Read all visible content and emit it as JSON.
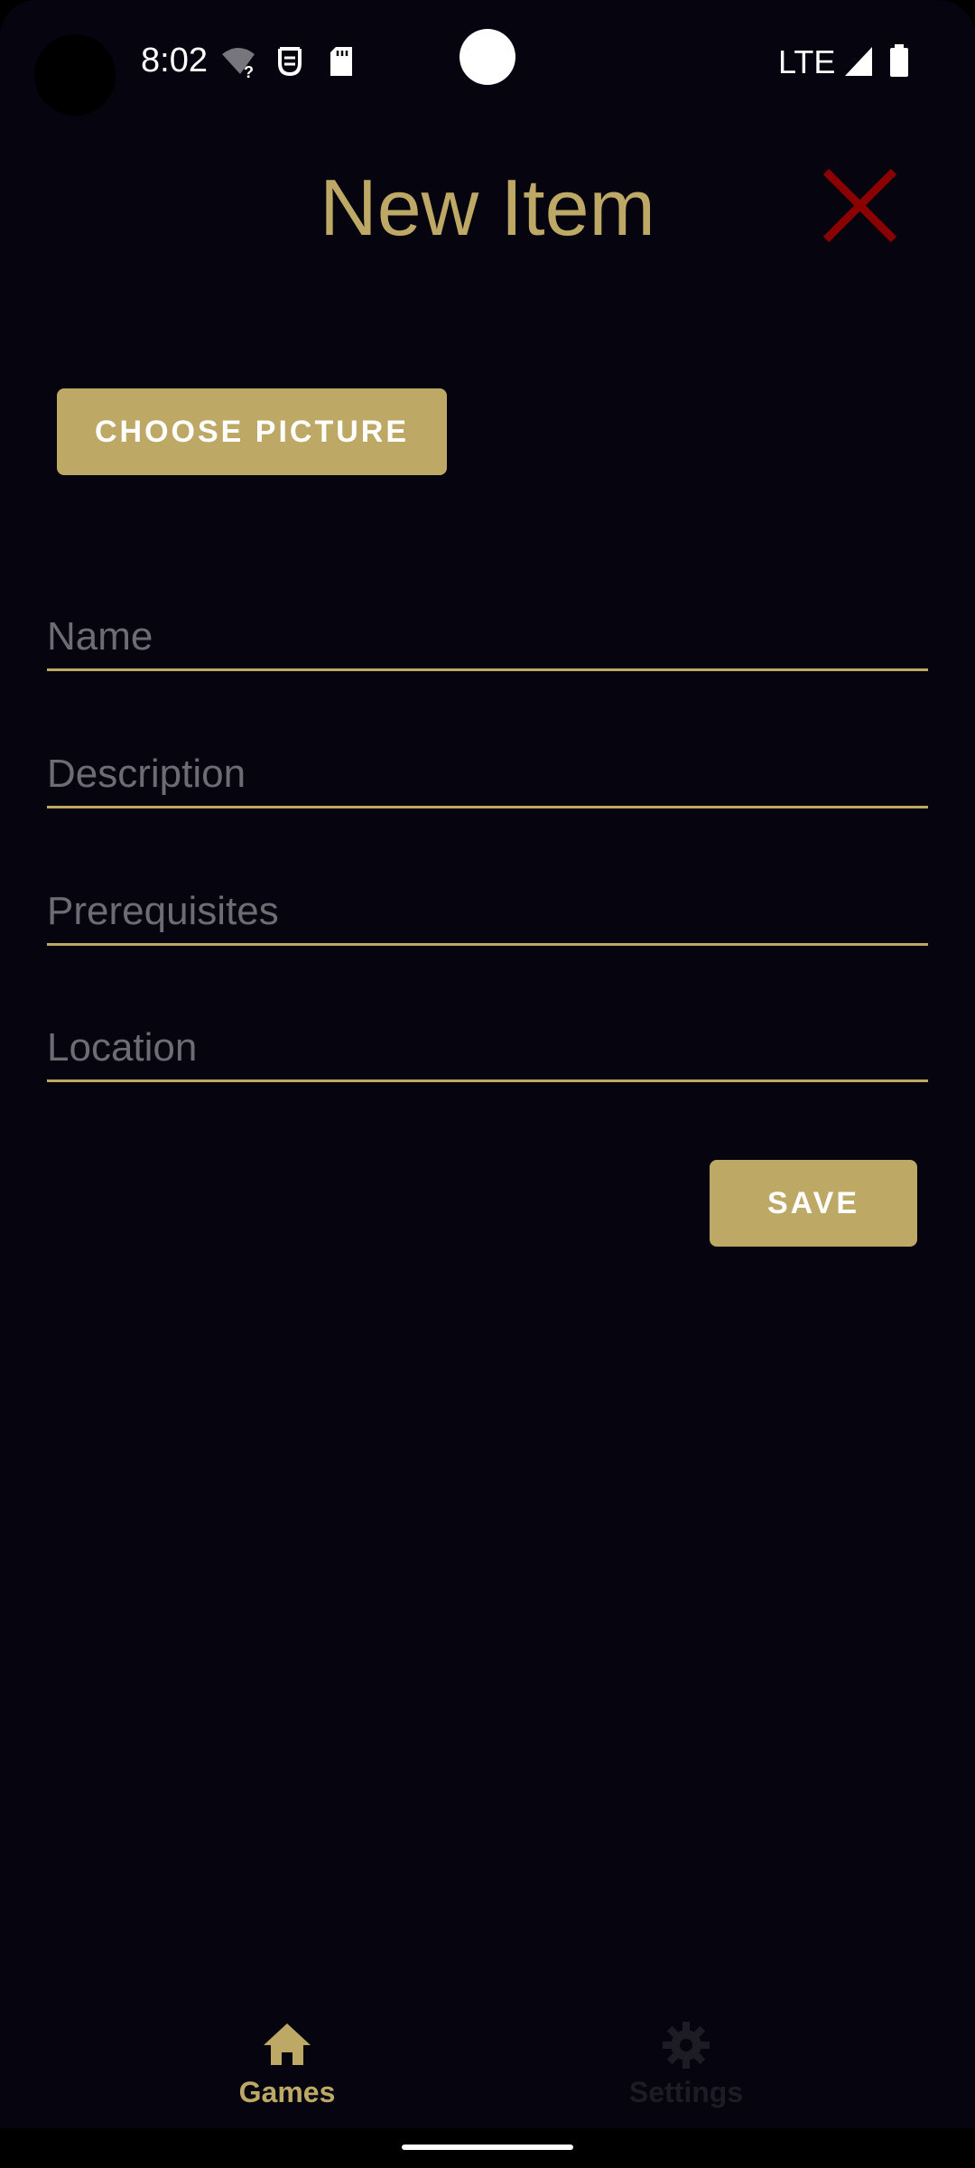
{
  "status_bar": {
    "time": "8:02",
    "network": "LTE",
    "icons": [
      "wifi-unknown-icon",
      "privacy-icon",
      "sd-card-icon",
      "signal-icon",
      "battery-icon"
    ]
  },
  "header": {
    "title": "New Item",
    "close_icon": "close-icon"
  },
  "form": {
    "choose_picture_label": "CHOOSE PICTURE",
    "fields": [
      {
        "placeholder": "Name",
        "value": ""
      },
      {
        "placeholder": "Description",
        "value": ""
      },
      {
        "placeholder": "Prerequisites",
        "value": ""
      },
      {
        "placeholder": "Location",
        "value": ""
      }
    ],
    "save_label": "SAVE"
  },
  "bottom_nav": {
    "items": [
      {
        "label": "Games",
        "icon": "home-icon",
        "active": true
      },
      {
        "label": "Settings",
        "icon": "gear-icon",
        "active": false
      }
    ]
  },
  "colors": {
    "accent": "#bea866",
    "background": "#05040f",
    "close": "#8b0000",
    "placeholder": "#6e6c73",
    "inactive_nav": "#1d1c25"
  }
}
